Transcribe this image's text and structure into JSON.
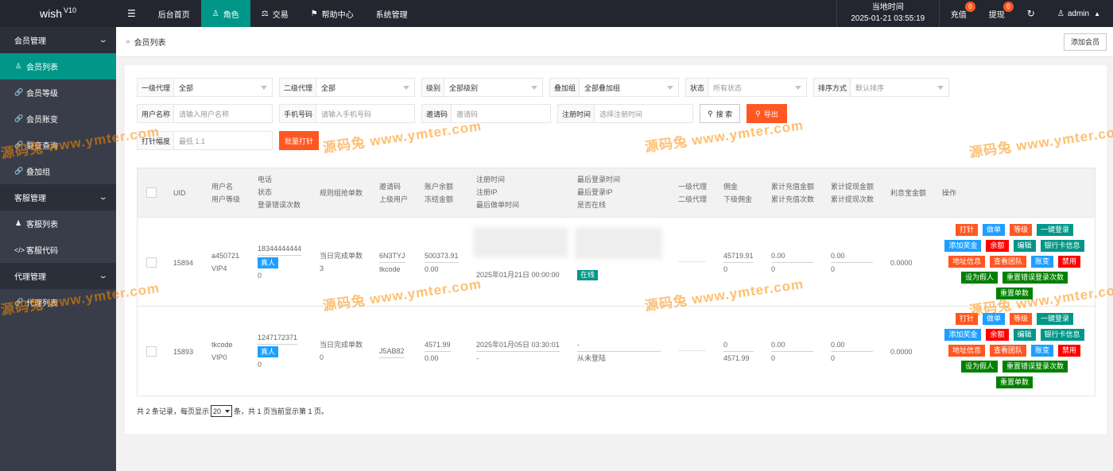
{
  "app": {
    "name": "wish",
    "version": "V10"
  },
  "topnav": {
    "menu_icon": "hamburger-icon",
    "items": [
      "后台首页",
      "角色",
      "交易",
      "帮助中心",
      "系统管理"
    ],
    "time_label": "当地时间",
    "time_value": "2025-01-21 03:55:19",
    "recharge": {
      "label": "充值",
      "badge": "0"
    },
    "withdraw": {
      "label": "提现",
      "badge": "0"
    },
    "user": "admin"
  },
  "sidebar": {
    "groups": [
      {
        "title": "会员管理",
        "items": [
          "会员列表",
          "会员等级",
          "会员账变",
          "裂变查询",
          "叠加组"
        ]
      },
      {
        "title": "客服管理",
        "items": [
          "客服列表",
          "客服代码"
        ]
      },
      {
        "title": "代理管理",
        "items": [
          "代理列表"
        ]
      }
    ]
  },
  "breadcrumb": {
    "current": "会员列表",
    "add_button": "添加会员"
  },
  "filters": {
    "level1": {
      "label": "一级代理",
      "value": "全部"
    },
    "level2": {
      "label": "二级代理",
      "value": "全部"
    },
    "grade": {
      "label": "级别",
      "value": "全部级别"
    },
    "stack": {
      "label": "叠加组",
      "value": "全部叠加组"
    },
    "status": {
      "label": "状态",
      "placeholder": "所有状态"
    },
    "sort": {
      "label": "排序方式",
      "placeholder": "默认排序"
    },
    "username": {
      "label": "用户名称",
      "placeholder": "请输入用户名称"
    },
    "phone": {
      "label": "手机号码",
      "placeholder": "请输入手机号码"
    },
    "invite": {
      "label": "邀请码",
      "placeholder": "邀请码"
    },
    "regtime": {
      "label": "注册时间",
      "placeholder": "选择注册时间"
    },
    "search_btn": "搜 索",
    "export_btn": "导出",
    "hit": {
      "label": "打针幅度",
      "placeholder": "最低 1.1"
    },
    "batch_btn": "批量打针"
  },
  "table": {
    "headers": {
      "uid": "UID",
      "user": [
        "用户名",
        "用户等级"
      ],
      "contact": [
        "电话",
        "状态",
        "登录错误次数"
      ],
      "rule": "规则组抢单数",
      "invite": [
        "邀请码",
        "上级用户"
      ],
      "balance": [
        "账户余额",
        "冻结金额"
      ],
      "reg": [
        "注册时间",
        "注册IP",
        "最后做单时间"
      ],
      "login": [
        "最后登录时间",
        "最后登录IP",
        "是否在线"
      ],
      "agent": [
        "一级代理",
        "二级代理"
      ],
      "commission": [
        "佣金",
        "下级佣金"
      ],
      "recharge": [
        "累计充值金额",
        "累计充值次数"
      ],
      "withdraw": [
        "累计提现金额",
        "累计提现次数"
      ],
      "interest": "利息宝金额",
      "ops": "操作"
    },
    "rows": [
      {
        "uid": "15894",
        "username": "a450721",
        "vip": "VIP4",
        "phone": "18344444444",
        "status": "真人",
        "login_err": "0",
        "rule_label": "当日完成单数",
        "rule_val": "3",
        "invite": "6N3TYJ",
        "parent": "tkcode",
        "balance": "500373.91",
        "frozen": "0.00",
        "reg_time": "",
        "last_order": "2025年01月21日 00:00:00",
        "last_login": "",
        "online": "在线",
        "commission": "45719.91",
        "sub_commission": "0",
        "recharge_amt": "0.00",
        "recharge_cnt": "0",
        "withdraw_amt": "0.00",
        "withdraw_cnt": "0",
        "interest": "0.0000"
      },
      {
        "uid": "15893",
        "username": "tkcode",
        "vip": "VIP0",
        "phone": "1247172371",
        "status": "真人",
        "login_err": "0",
        "rule_label": "当日完成单数",
        "rule_val": "0",
        "invite": "J5AB82",
        "parent": "",
        "balance": "4571.99",
        "frozen": "0.00",
        "reg_time": "2025年01月05日 03:30:01",
        "last_order": "-",
        "last_login": "-",
        "online": "从未登陆",
        "commission": "0",
        "sub_commission": "4571.99",
        "recharge_amt": "0.00",
        "recharge_cnt": "0",
        "withdraw_amt": "0.00",
        "withdraw_cnt": "0",
        "interest": "0.0000"
      }
    ],
    "ops": {
      "hit": "打针",
      "order": "做单",
      "grade": "等级",
      "one_login": "一键登录",
      "bonus": "添加奖金",
      "balance": "余额",
      "edit": "编辑",
      "bank": "银行卡信息",
      "address": "地址信息",
      "team": "查看团队",
      "change": "账变",
      "ban": "禁用",
      "fake": "设为假人",
      "reset_err": "重置错误登录次数",
      "reset_orders": "重置单数"
    }
  },
  "pager": {
    "prefix": "共 2 条记录，每页显示",
    "size": "20",
    "suffix": "条，共 1 页当前显示第 1 页。"
  },
  "watermark": {
    "brand": "源码兔",
    "url": "www.ymter.com"
  }
}
